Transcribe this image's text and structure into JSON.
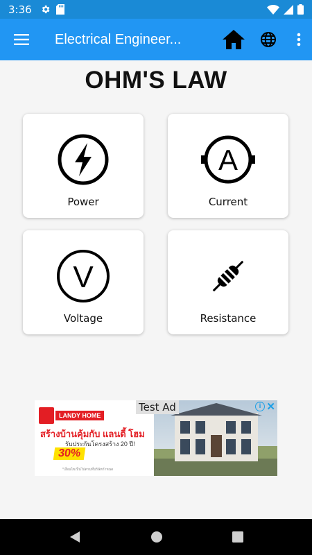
{
  "status_bar": {
    "time": "3:36"
  },
  "app_bar": {
    "title": "Electrical Engineer..."
  },
  "page": {
    "title": "OHM'S LAW"
  },
  "cards": [
    {
      "label": "Power",
      "icon": "power-lightning-icon"
    },
    {
      "label": "Current",
      "icon": "ammeter-icon"
    },
    {
      "label": "Voltage",
      "icon": "voltmeter-icon"
    },
    {
      "label": "Resistance",
      "icon": "resistor-icon"
    }
  ],
  "ad": {
    "tag": "Test Ad",
    "brand": "LANDY HOME",
    "headline": "สร้างบ้านคุ้มกับ แลนดี้ โฮม",
    "subline": "รับประกันโครงสร้าง 20 ปี!",
    "promo": "30%",
    "fine_print": "*เงื่อนไขเป็นไปตามที่บริษัทกำหนด"
  },
  "colors": {
    "status_bar": "#1a8ad6",
    "app_bar": "#2196f3",
    "background": "#f5f5f5"
  }
}
